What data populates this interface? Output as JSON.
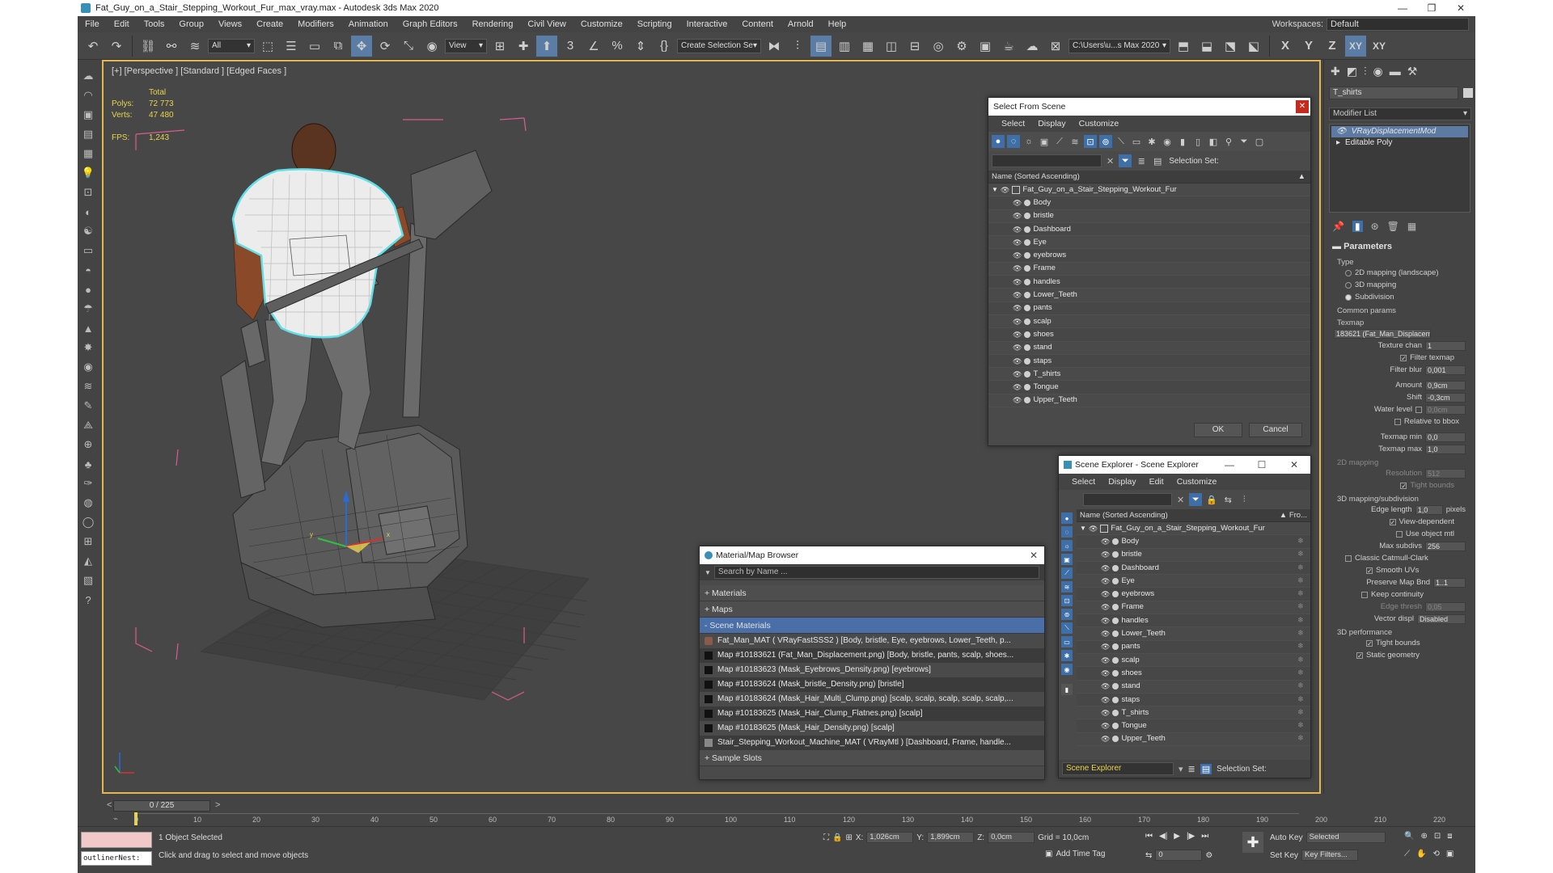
{
  "window": {
    "title": "Fat_Guy_on_a_Stair_Stepping_Workout_Fur_max_vray.max - Autodesk 3ds Max 2020",
    "controls": [
      "—",
      "❐",
      "✕"
    ]
  },
  "menubar": {
    "items": [
      "File",
      "Edit",
      "Tools",
      "Group",
      "Views",
      "Create",
      "Modifiers",
      "Animation",
      "Graph Editors",
      "Rendering",
      "Civil View",
      "Customize",
      "Scripting",
      "Interactive",
      "Content",
      "Arnold",
      "Help"
    ],
    "workspace_label": "Workspaces:",
    "workspace_value": "Default"
  },
  "toolbar": {
    "filter_value": "All",
    "view_value": "View",
    "selection_set": "Create Selection Se",
    "path_value": "C:\\Users\\u...s Max 2020",
    "axis_labels": [
      "X",
      "Y",
      "Z",
      "XY",
      "XY"
    ]
  },
  "viewport": {
    "label": "[+] [Perspective ] [Standard ] [Edged Faces ]",
    "stats": {
      "total_label": "Total",
      "polys_label": "Polys:",
      "polys_value": "72 773",
      "verts_label": "Verts:",
      "verts_value": "47 480",
      "fps_label": "FPS:",
      "fps_value": "1,243"
    }
  },
  "select_from_scene": {
    "title": "Select From Scene",
    "menu": [
      "Select",
      "Display",
      "Customize"
    ],
    "selection_set_label": "Selection Set:",
    "header": "Name (Sorted Ascending)",
    "root": "Fat_Guy_on_a_Stair_Stepping_Workout_Fur",
    "items": [
      "Body",
      "bristle",
      "Dashboard",
      "Eye",
      "eyebrows",
      "Frame",
      "handles",
      "Lower_Teeth",
      "pants",
      "scalp",
      "shoes",
      "stand",
      "staps",
      "T_shirts",
      "Tongue",
      "Upper_Teeth"
    ],
    "ok_label": "OK",
    "cancel_label": "Cancel"
  },
  "scene_explorer": {
    "title": "Scene Explorer - Scene Explorer",
    "menu": [
      "Select",
      "Display",
      "Edit",
      "Customize"
    ],
    "header": "Name (Sorted Ascending)",
    "header_right": "▲ Fro...",
    "root": "Fat_Guy_on_a_Stair_Stepping_Workout_Fur",
    "items": [
      "Body",
      "bristle",
      "Dashboard",
      "Eye",
      "eyebrows",
      "Frame",
      "handles",
      "Lower_Teeth",
      "pants",
      "scalp",
      "shoes",
      "stand",
      "staps",
      "T_shirts",
      "Tongue",
      "Upper_Teeth"
    ],
    "footer_dropdown": "Scene Explorer",
    "selection_set_label": "Selection Set:"
  },
  "material_browser": {
    "title": "Material/Map Browser",
    "search_placeholder": "Search by Name ...",
    "sections": [
      "+ Materials",
      "+ Maps",
      "- Scene Materials"
    ],
    "rows": [
      "Fat_Man_MAT  ( VRayFastSSS2 )  [Body, bristle, Eye, eyebrows, Lower_Teeth, p...",
      "Map #10183621 (Fat_Man_Displacement.png) [Body, bristle, pants, scalp, shoes...",
      "Map #10183623 (Mask_Eyebrows_Density.png) [eyebrows]",
      "Map #10183624 (Mask_bristle_Density.png) [bristle]",
      "Map #10183624 (Mask_Hair_Multi_Clump.png) [scalp, scalp, scalp, scalp, scalp,...",
      "Map #10183625 (Mask_Hair_Clump_Flatnes.png) [scalp]",
      "Map #10183625 (Mask_Hair_Density.png) [scalp]",
      "Stair_Stepping_Workout_Machine_MAT  ( VRayMtl )  [Dashboard, Frame, handle..."
    ],
    "footer_section": "+ Sample Slots"
  },
  "command_panel": {
    "object_name": "T_shirts",
    "modifier_list": "Modifier List",
    "stack": [
      "VRayDisplacementMod",
      "Editable Poly"
    ],
    "parameters_title": "Parameters",
    "type_label": "Type",
    "type_options": [
      "2D mapping (landscape)",
      "3D mapping",
      "Subdivision"
    ],
    "common_params": "Common params",
    "texmap_label": "Texmap",
    "texmap_value": "183621 (Fat_Man_Displacem",
    "texture_chan_label": "Texture chan",
    "texture_chan_value": "1",
    "filter_texmap": "Filter texmap",
    "filter_blur_label": "Filter blur",
    "filter_blur_value": "0,001",
    "amount_label": "Amount",
    "amount_value": "0,9cm",
    "shift_label": "Shift",
    "shift_value": "-0,3cm",
    "water_level_label": "Water level",
    "water_level_value": "0,0cm",
    "relative_bbox": "Relative to bbox",
    "texmap_min_label": "Texmap min",
    "texmap_min_value": "0,0",
    "texmap_max_label": "Texmap max",
    "texmap_max_value": "1,0",
    "mapping_2d": "2D mapping",
    "resolution_label": "Resolution",
    "resolution_value": "512",
    "tight_bounds_1": "Tight bounds",
    "mapping_3d": "3D mapping/subdivision",
    "edge_length_label": "Edge length",
    "edge_length_value": "1,0",
    "pixels_label": "pixels",
    "view_dependent": "View-dependent",
    "use_object_mtl": "Use object mtl",
    "max_subdivs_label": "Max subdivs",
    "max_subdivs_value": "256",
    "classic_catmull": "Classic Catmull-Clark",
    "smooth_uvs": "Smooth UVs",
    "preserve_map_label": "Preserve Map Bnd",
    "preserve_map_value": "1..1",
    "keep_continuity": "Keep continuity",
    "edge_thresh_label": "Edge thresh",
    "edge_thresh_value": "0,05",
    "vector_displ_label": "Vector displ",
    "vector_displ_value": "Disabled",
    "perf_label": "3D performance",
    "tight_bounds_2": "Tight bounds",
    "static_geometry": "Static geometry"
  },
  "timeline": {
    "slider_label": "0 / 225",
    "ticks": [
      "0",
      "10",
      "20",
      "30",
      "40",
      "50",
      "60",
      "70",
      "80",
      "90",
      "100",
      "110",
      "120",
      "130",
      "140",
      "150",
      "160",
      "170",
      "180",
      "190",
      "200",
      "210",
      "220"
    ]
  },
  "status": {
    "listener_text": "outlinerNest:",
    "selected_text": "1 Object Selected",
    "prompt_text": "Click and drag to select and move objects",
    "x_label": "X:",
    "x_value": "1,026cm",
    "y_label": "Y:",
    "y_value": "1,899cm",
    "z_label": "Z:",
    "z_value": "0,0cm",
    "grid_text": "Grid = 10,0cm",
    "add_time_tag": "Add Time Tag",
    "auto_key": "Auto Key",
    "set_key": "Set Key",
    "key_mode_value": "Selected",
    "key_filters": "Key Filters...",
    "frame_value": "0"
  },
  "colors": {
    "selection_cyan": "#5fe0e8",
    "bbox_pink": "#d95d8c",
    "viewport_border": "#e3b74c",
    "stats_yellow": "#e9d44c",
    "highlight_blue": "#4a6fa8"
  }
}
